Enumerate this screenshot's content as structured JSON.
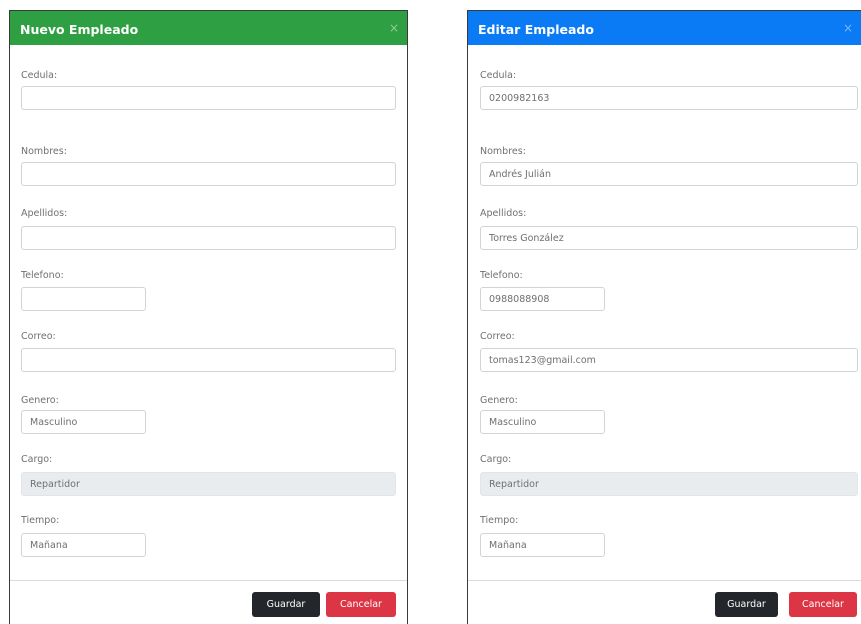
{
  "new_employee": {
    "title": "Nuevo Empleado",
    "close_icon": "×",
    "fields": {
      "cedula": {
        "label": "Cedula:",
        "value": ""
      },
      "nombres": {
        "label": "Nombres:",
        "value": ""
      },
      "apellidos": {
        "label": "Apellidos:",
        "value": ""
      },
      "telefono": {
        "label": "Telefono:",
        "value": ""
      },
      "correo": {
        "label": "Correo:",
        "value": ""
      },
      "genero": {
        "label": "Genero:",
        "value": "Masculino"
      },
      "cargo": {
        "label": "Cargo:",
        "value": "Repartidor"
      },
      "tiempo": {
        "label": "Tiempo:",
        "value": "Mañana"
      }
    },
    "buttons": {
      "save": "Guardar",
      "cancel": "Cancelar"
    }
  },
  "edit_employee": {
    "title": "Editar Empleado",
    "close_icon": "×",
    "fields": {
      "cedula": {
        "label": "Cedula:",
        "value": "0200982163"
      },
      "nombres": {
        "label": "Nombres:",
        "value": "Andrés Julián"
      },
      "apellidos": {
        "label": "Apellidos:",
        "value": "Torres González"
      },
      "telefono": {
        "label": "Telefono:",
        "value": "0988088908"
      },
      "correo": {
        "label": "Correo:",
        "value": "tomas123@gmail.com"
      },
      "genero": {
        "label": "Genero:",
        "value": "Masculino"
      },
      "cargo": {
        "label": "Cargo:",
        "value": "Repartidor"
      },
      "tiempo": {
        "label": "Tiempo:",
        "value": "Mañana"
      }
    },
    "buttons": {
      "save": "Guardar",
      "cancel": "Cancelar"
    }
  },
  "colors": {
    "new_header": "#2ea043",
    "edit_header": "#0b7af5",
    "save_button": "#23272b",
    "cancel_button": "#dc3545",
    "readonly_field": "#e9ecef"
  }
}
